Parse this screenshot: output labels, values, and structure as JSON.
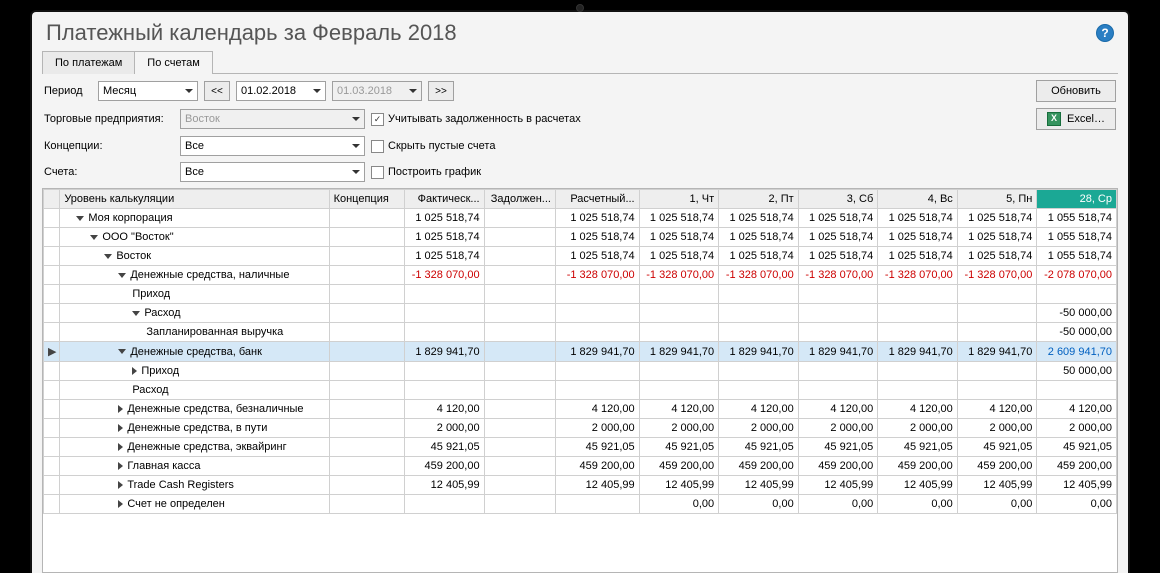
{
  "title": "Платежный календарь за Февраль 2018",
  "tabs": {
    "payments": "По платежам",
    "accounts": "По счетам"
  },
  "filters": {
    "period_label": "Период",
    "period_value": "Месяц",
    "prev": "<<",
    "next": ">>",
    "date_from": "01.02.2018",
    "date_to": "01.03.2018",
    "update": "Обновить",
    "enterprises_label": "Торговые предприятия:",
    "enterprises_value": "Восток",
    "debt_chk": "Учитывать задолженность в расчетах",
    "debt_checked": "✓",
    "excel": "Excel…",
    "concepts_label": "Концепции:",
    "concepts_value": "Все",
    "hide_empty_chk": "Скрыть пустые счета",
    "accounts_label": "Счета:",
    "accounts_value": "Все",
    "build_chart_chk": "Построить график"
  },
  "headers": {
    "level": "Уровень калькуляции",
    "concept": "Концепция",
    "fact": "Фактическ...",
    "debt": "Задолжен...",
    "calc": "Расчетный...",
    "d1": "1, Чт",
    "d2": "2, Пт",
    "d3": "3, Сб",
    "d4": "4, Вс",
    "d5": "5, Пн",
    "d28": "28, Ср"
  },
  "rows": [
    {
      "name": "Моя корпорация",
      "ind": 1,
      "tri": "open",
      "fact": "1 025 518,74",
      "calc": "1 025 518,74",
      "d1": "1 025 518,74",
      "d2": "1 025 518,74",
      "d3": "1 025 518,74",
      "d4": "1 025 518,74",
      "d5": "1 025 518,74",
      "d28": "1 055 518,74"
    },
    {
      "name": "ООО \"Восток\"",
      "ind": 2,
      "tri": "open",
      "fact": "1 025 518,74",
      "calc": "1 025 518,74",
      "d1": "1 025 518,74",
      "d2": "1 025 518,74",
      "d3": "1 025 518,74",
      "d4": "1 025 518,74",
      "d5": "1 025 518,74",
      "d28": "1 055 518,74"
    },
    {
      "name": "Восток",
      "ind": 3,
      "tri": "open",
      "fact": "1 025 518,74",
      "calc": "1 025 518,74",
      "d1": "1 025 518,74",
      "d2": "1 025 518,74",
      "d3": "1 025 518,74",
      "d4": "1 025 518,74",
      "d5": "1 025 518,74",
      "d28": "1 055 518,74"
    },
    {
      "name": "Денежные средства, наличные",
      "ind": 4,
      "tri": "open",
      "fact": "-1 328 070,00",
      "calc": "-1 328 070,00",
      "d1": "-1 328 070,00",
      "d2": "-1 328 070,00",
      "d3": "-1 328 070,00",
      "d4": "-1 328 070,00",
      "d5": "-1 328 070,00",
      "d28": "-2 078 070,00",
      "neg": true
    },
    {
      "name": "Приход",
      "ind": 5,
      "tri": ""
    },
    {
      "name": "Расход",
      "ind": 5,
      "tri": "open",
      "d28": "-50 000,00"
    },
    {
      "name": "Запланированная выручка",
      "ind": 6,
      "tri": "",
      "d28": "-50 000,00"
    },
    {
      "name": "Денежные средства, банк",
      "ind": 4,
      "tri": "open",
      "sel": true,
      "fact": "1 829 941,70",
      "calc": "1 829 941,70",
      "d1": "1 829 941,70",
      "d2": "1 829 941,70",
      "d3": "1 829 941,70",
      "d4": "1 829 941,70",
      "d5": "1 829 941,70",
      "d28": "2 609 941,70",
      "pos": true
    },
    {
      "name": "Приход",
      "ind": 5,
      "tri": "closed",
      "d28": "50 000,00"
    },
    {
      "name": "Расход",
      "ind": 5,
      "tri": ""
    },
    {
      "name": "Денежные средства, безналичные",
      "ind": 4,
      "tri": "closed",
      "fact": "4 120,00",
      "calc": "4 120,00",
      "d1": "4 120,00",
      "d2": "4 120,00",
      "d3": "4 120,00",
      "d4": "4 120,00",
      "d5": "4 120,00",
      "d28": "4 120,00"
    },
    {
      "name": "Денежные средства, в пути",
      "ind": 4,
      "tri": "closed",
      "fact": "2 000,00",
      "calc": "2 000,00",
      "d1": "2 000,00",
      "d2": "2 000,00",
      "d3": "2 000,00",
      "d4": "2 000,00",
      "d5": "2 000,00",
      "d28": "2 000,00"
    },
    {
      "name": "Денежные средства, эквайринг",
      "ind": 4,
      "tri": "closed",
      "fact": "45 921,05",
      "calc": "45 921,05",
      "d1": "45 921,05",
      "d2": "45 921,05",
      "d3": "45 921,05",
      "d4": "45 921,05",
      "d5": "45 921,05",
      "d28": "45 921,05"
    },
    {
      "name": "Главная касса",
      "ind": 4,
      "tri": "closed",
      "fact": "459 200,00",
      "calc": "459 200,00",
      "d1": "459 200,00",
      "d2": "459 200,00",
      "d3": "459 200,00",
      "d4": "459 200,00",
      "d5": "459 200,00",
      "d28": "459 200,00"
    },
    {
      "name": "Trade Cash Registers",
      "ind": 4,
      "tri": "closed",
      "fact": "12 405,99",
      "calc": "12 405,99",
      "d1": "12 405,99",
      "d2": "12 405,99",
      "d3": "12 405,99",
      "d4": "12 405,99",
      "d5": "12 405,99",
      "d28": "12 405,99"
    },
    {
      "name": "Счет не определен",
      "ind": 4,
      "tri": "closed",
      "d1": "0,00",
      "d2": "0,00",
      "d3": "0,00",
      "d4": "0,00",
      "d5": "0,00",
      "d28": "0,00"
    }
  ]
}
